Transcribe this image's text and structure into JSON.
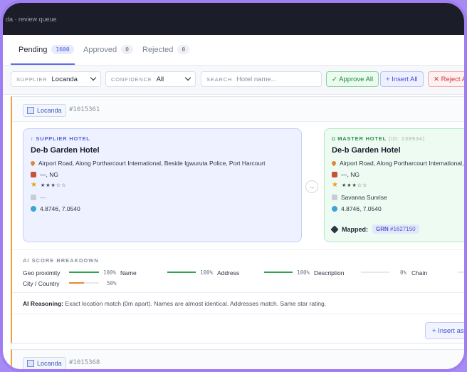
{
  "app": {
    "title": "da · review queue"
  },
  "tabs": [
    {
      "label": "Pending",
      "count": "1600"
    },
    {
      "label": "Approved",
      "count": "0"
    },
    {
      "label": "Rejected",
      "count": "0"
    }
  ],
  "filters": {
    "supplier": {
      "label": "SUPPLIER",
      "value": "Locanda"
    },
    "confidence": {
      "label": "CONFIDENCE",
      "value": "All"
    },
    "search": {
      "label": "SEARCH",
      "placeholder": "Hotel name..."
    }
  },
  "actions": {
    "approve_all": "✓ Approve All",
    "insert_all": "+ Insert All",
    "reject_all": "✕ Reject All"
  },
  "cards": [
    {
      "source": "Locanda",
      "id": "#1015361",
      "supplier": {
        "tag": "↑ SUPPLIER HOTEL",
        "name": "De-b Garden Hotel",
        "address": "Airport Road, Along Portharcourt International, Beside Igwuruta Police, Port Harcourt",
        "country": "—, NG",
        "stars": "★★★☆☆",
        "chain": "—",
        "coords": "4.8746, 7.0540"
      },
      "master": {
        "tag": "MASTER HOTEL",
        "id": "(ID: 238934)",
        "name": "De-b Garden Hotel",
        "address": "Airport Road, Along Portharcourt International,",
        "country": "—, NG",
        "stars": "★★★☆☆",
        "chain": "Savanna Sunrise",
        "coords": "4.8746, 7.0540",
        "mapped_label": "Mapped:",
        "mapped_prefix": "GRN",
        "mapped_code": "#1627150"
      },
      "breakdown_title": "AI SCORE BREAKDOWN",
      "scores": [
        {
          "label": "Geo proximity",
          "pct": "100%",
          "value": 100
        },
        {
          "label": "Name",
          "pct": "100%",
          "value": 100
        },
        {
          "label": "Address",
          "pct": "100%",
          "value": 100
        },
        {
          "label": "Description",
          "pct": "0%",
          "value": 0
        },
        {
          "label": "Chain",
          "pct": "",
          "value": 0
        },
        {
          "label": "City / Country",
          "pct": "50%",
          "value": 50
        }
      ],
      "reasoning_label": "AI Reasoning:",
      "reasoning": "Exact location match (0m apart). Names are almost identical. Addresses match. Same star rating.",
      "insert_button": "+ Insert as N"
    },
    {
      "source": "Locanda",
      "id": "#1015368"
    }
  ],
  "colors": {
    "accent": "#5b6df0",
    "approve": "#23863f",
    "reject": "#d23737",
    "warn": "#f0a23a"
  }
}
